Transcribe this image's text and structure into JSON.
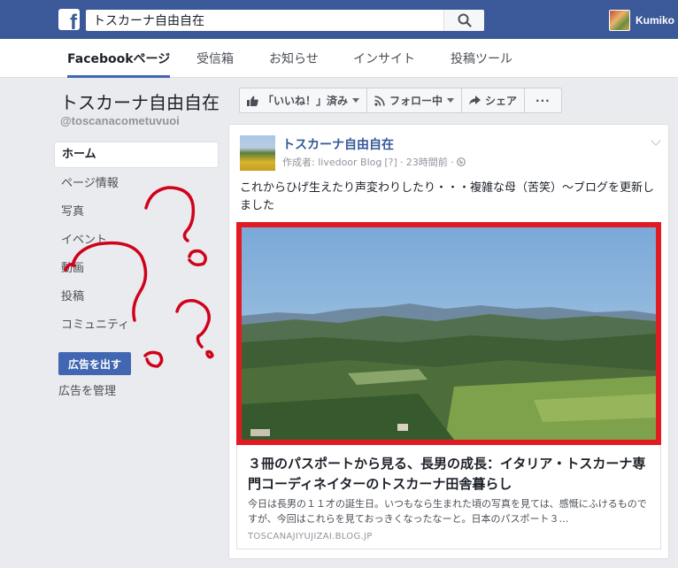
{
  "topbar": {
    "search_value": "トスカーナ自由自在",
    "profile_name": "Kumiko"
  },
  "tabs": [
    "Facebookページ",
    "受信箱",
    "お知らせ",
    "インサイト",
    "投稿ツール"
  ],
  "page": {
    "title": "トスカーナ自由自在",
    "handle": "@toscanacometuvuoi"
  },
  "sidebar": {
    "items": [
      "ホーム",
      "ページ情報",
      "写真",
      "イベント",
      "動画",
      "投稿",
      "コミュニティ"
    ],
    "ad_button": "広告を出す",
    "manage_ads": "広告を管理"
  },
  "actions": {
    "like": "「いいね！」済み",
    "follow": "フォロー中",
    "share": "シェア",
    "more": "···"
  },
  "post": {
    "author": "トスカーナ自由自在",
    "meta_by": "作成者: livedoor Blog",
    "meta_help": "[?]",
    "meta_time": "· 23時間前 ·",
    "text": "これからひげ生えたり声変わりしたり・・・複雑な母（苦笑）〜ブログを更新しました",
    "link": {
      "title": "３冊のパスポートから見る、長男の成長：イタリア・トスカーナ専門コーディネイターのトスカーナ田舎暮らし",
      "description": "今日は長男の１１才の誕生日。いつもなら生まれた頃の写真を見ては、感慨にふけるものですが、今回はこれらを見ておっきくなったなーと。日本のパスポート３…",
      "domain": "TOSCANAJIYUJIZAI.BLOG.JP"
    }
  },
  "colors": {
    "brand": "#3b5998",
    "highlight_border": "#e21b23",
    "annotation": "#d0021b"
  }
}
